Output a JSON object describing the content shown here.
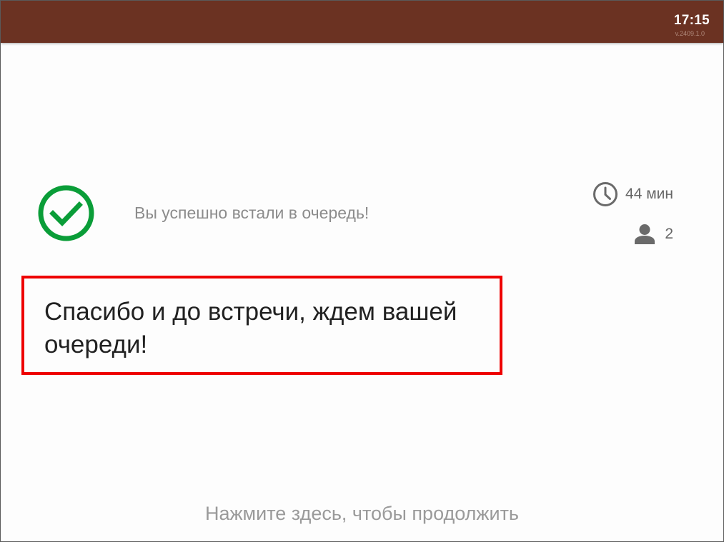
{
  "header": {
    "time": "17:15",
    "version": "v.2409.1.0"
  },
  "status": {
    "message": "Вы успешно встали в очередь!",
    "wait_time": "44 мин",
    "people_ahead": "2"
  },
  "thanks": {
    "text": "Спасибо и до встречи, ждем вашей очереди!"
  },
  "footer": {
    "continue_label": "Нажмите здесь, чтобы продолжить"
  },
  "icons": {
    "check": "check-circle-icon",
    "wait": "clock-icon",
    "people": "person-icon"
  },
  "colors": {
    "header_bg": "#6b3222",
    "success_green": "#0a9d38",
    "highlight_red": "#ee0000"
  }
}
